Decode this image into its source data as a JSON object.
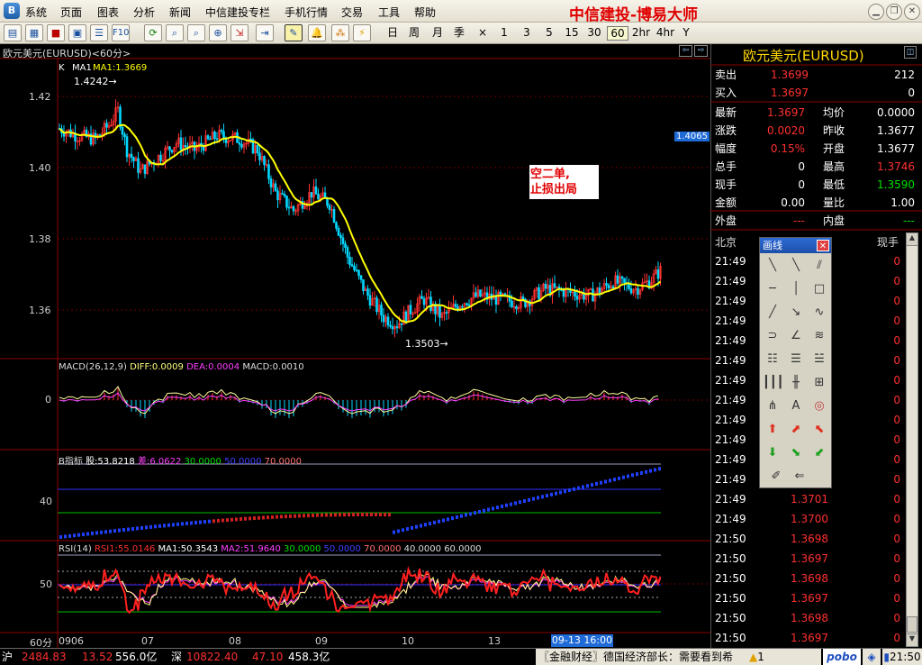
{
  "menubar": {
    "app_icon": "app-icon",
    "items": [
      "系统",
      "页面",
      "图表",
      "分析",
      "新闻",
      "中信建投专栏",
      "手机行情",
      "交易",
      "工具",
      "帮助"
    ],
    "brand": "中信建投-博易大师",
    "window_buttons": [
      "minimize-icon",
      "restore-icon",
      "close-icon"
    ]
  },
  "toolbar": {
    "icon_buttons": [
      "quote-list-icon",
      "menu-grid-icon",
      "box-icon",
      "f10-icon",
      "refresh-icon",
      "zoom-in-icon",
      "zoom-out-icon",
      "export-icon",
      "import-icon",
      "draw-icon",
      "alarm-icon",
      "multi-icon",
      "flash-icon"
    ],
    "f10_label": "F10",
    "periods": [
      "日",
      "周",
      "月",
      "季",
      "×",
      "1",
      "3",
      "5",
      "15",
      "30",
      "60",
      "2hr",
      "4hr",
      "Y"
    ],
    "active_period": "60"
  },
  "chart": {
    "title": "欧元美元(EURUSD)<60分>",
    "price_panel": {
      "label": "K  MA1  MA1:1.3669",
      "k": "K",
      "ma_label": "MA1",
      "ma_value": "MA1:1.3669",
      "y_ticks": [
        "1.42",
        "1.40",
        "1.38",
        "1.36"
      ],
      "high_mark": "1.4242",
      "low_mark": "1.3503",
      "price_tag": "1.4065",
      "annotation_line1": "空二单,",
      "annotation_line2": "止损出局"
    },
    "macd_panel": {
      "name": "MACD(26,12,9)",
      "diff": "DIFF:0.0009",
      "dea": "DEA:0.0004",
      "macd": "MACD:0.0010",
      "zero_tick": "0"
    },
    "b_panel": {
      "name": "B指标",
      "gu": "股:53.8218",
      "cha": "差:6.0622",
      "v30": "30.0000",
      "v50": "50.0000",
      "v70": "70.0000",
      "tick": "40"
    },
    "rsi_panel": {
      "name": "RSI(14)",
      "rsi1": "RSI1:55.0146",
      "ma1": "MA1:50.3543",
      "ma2": "MA2:51.9640",
      "v30": "30.0000",
      "v50": "50.0000",
      "v70": "70.0000",
      "v40": "40.0000",
      "v60": "60.0000",
      "tick": "50"
    },
    "x_axis": {
      "period_label": "60分",
      "labels": [
        "0906",
        "07",
        "08",
        "09",
        "10",
        "13"
      ],
      "cursor_time": "09-13 16:00"
    },
    "nav_buttons": [
      "scroll-left-icon",
      "scroll-right-icon"
    ]
  },
  "quote": {
    "symbol": "欧元美元(EURUSD)",
    "sell_label": "卖出",
    "sell_price": "1.3699",
    "sell_vol": "212",
    "buy_label": "买入",
    "buy_price": "1.3697",
    "buy_vol": "0",
    "rows": [
      {
        "l1": "最新",
        "v1": "1.3697",
        "c1": "red",
        "l2": "均价",
        "v2": "0.0000",
        "c2": "wht"
      },
      {
        "l1": "涨跌",
        "v1": "0.0020",
        "c1": "red",
        "l2": "昨收",
        "v2": "1.3677",
        "c2": "wht"
      },
      {
        "l1": "幅度",
        "v1": "0.15%",
        "c1": "red",
        "l2": "开盘",
        "v2": "1.3677",
        "c2": "wht"
      },
      {
        "l1": "总手",
        "v1": "0",
        "c1": "wht",
        "l2": "最高",
        "v2": "1.3746",
        "c2": "red"
      },
      {
        "l1": "现手",
        "v1": "0",
        "c1": "wht",
        "l2": "最低",
        "v2": "1.3590",
        "c2": "grn"
      },
      {
        "l1": "金额",
        "v1": "0.00",
        "c1": "wht",
        "l2": "量比",
        "v2": "1.00",
        "c2": "wht"
      }
    ],
    "waipan_label": "外盘",
    "waipan_value": "---",
    "neipan_label": "内盘",
    "neipan_value": "---",
    "ticks_header": {
      "time": "北京",
      "vol": "现手"
    },
    "ticks": [
      {
        "t": "21:49",
        "p": "",
        "v": "0"
      },
      {
        "t": "21:49",
        "p": "",
        "v": "0"
      },
      {
        "t": "21:49",
        "p": "",
        "v": "0"
      },
      {
        "t": "21:49",
        "p": "",
        "v": "0"
      },
      {
        "t": "21:49",
        "p": "",
        "v": "0"
      },
      {
        "t": "21:49",
        "p": "",
        "v": "0"
      },
      {
        "t": "21:49",
        "p": "",
        "v": "0"
      },
      {
        "t": "21:49",
        "p": "",
        "v": "0"
      },
      {
        "t": "21:49",
        "p": "",
        "v": "0"
      },
      {
        "t": "21:49",
        "p": "",
        "v": "0"
      },
      {
        "t": "21:49",
        "p": "",
        "v": "0"
      },
      {
        "t": "21:49",
        "p": "",
        "v": "0"
      },
      {
        "t": "21:49",
        "p": "1.3701",
        "v": "0"
      },
      {
        "t": "21:49",
        "p": "1.3700",
        "v": "0"
      },
      {
        "t": "21:50",
        "p": "1.3698",
        "v": "0"
      },
      {
        "t": "21:50",
        "p": "1.3697",
        "v": "0"
      },
      {
        "t": "21:50",
        "p": "1.3698",
        "v": "0"
      },
      {
        "t": "21:50",
        "p": "1.3697",
        "v": "0"
      },
      {
        "t": "21:50",
        "p": "1.3698",
        "v": "0"
      },
      {
        "t": "21:50",
        "p": "1.3697",
        "v": "0"
      }
    ]
  },
  "draw_panel": {
    "title": "画线",
    "tools": [
      "line-segment-icon",
      "ray-icon",
      "parallel-line-icon",
      "horizontal-line-icon",
      "vertical-line-icon",
      "rectangle-icon",
      "trend-line-icon",
      "arrow-line-icon",
      "wave-line-icon",
      "arc-icon",
      "angle-icon",
      "fan-icon",
      "fibonacci-icon",
      "fib-retrace-icon",
      "fib-ext-icon",
      "cycle-lines-icon",
      "gann-lines-icon",
      "speed-lines-icon",
      "gann-fan-icon",
      "text-icon",
      "circle-icon",
      "up-arrow-icon",
      "up-right-arrow-icon",
      "up-left-arrow-icon",
      "down-arrow-icon",
      "down-right-arrow-icon",
      "down-left-arrow-icon",
      "eraser-icon",
      "delete-lines-icon"
    ],
    "text_tool_label": "A"
  },
  "status": {
    "sh_label": "沪",
    "sh_index": "2484.83",
    "sh_change": "13.52",
    "sh_amount": "556.0亿",
    "sz_label": "深",
    "sz_index": "10822.40",
    "sz_change": "47.10",
    "sz_amount": "458.3亿",
    "news": "〖金融财经〗德国经济部长：需要看到希",
    "alert_count": "1",
    "logo": "pobo",
    "clock": "21:50"
  }
}
